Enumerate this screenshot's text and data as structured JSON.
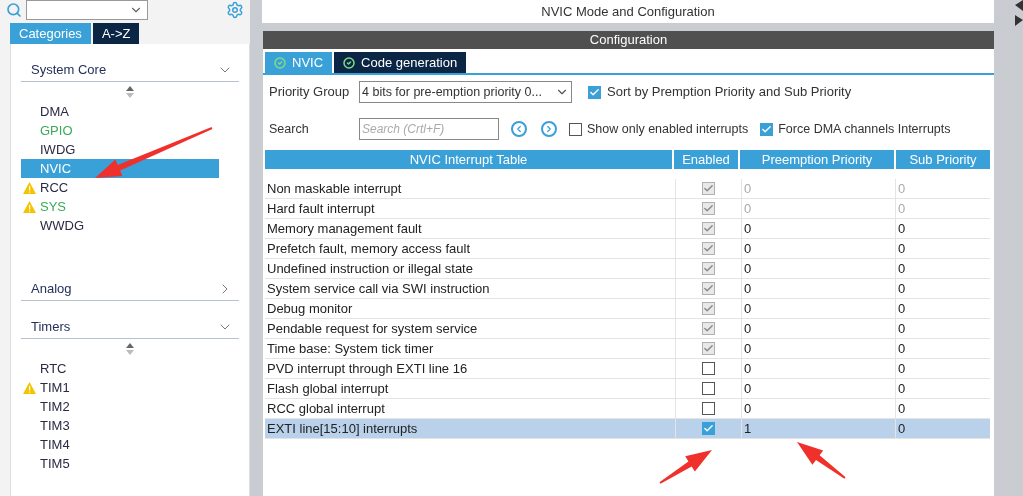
{
  "sidebar": {
    "tabs": [
      {
        "label": "Categories",
        "selected": true
      },
      {
        "label": "A->Z",
        "selected": false
      }
    ],
    "sections": [
      {
        "title": "System Core",
        "expanded": true,
        "items": [
          {
            "label": "DMA",
            "configured": false,
            "warning": false,
            "selected": false
          },
          {
            "label": "GPIO",
            "configured": true,
            "warning": false,
            "selected": false
          },
          {
            "label": "IWDG",
            "configured": false,
            "warning": false,
            "selected": false
          },
          {
            "label": "NVIC",
            "configured": false,
            "warning": false,
            "selected": true
          },
          {
            "label": "RCC",
            "configured": false,
            "warning": true,
            "selected": false
          },
          {
            "label": "SYS",
            "configured": true,
            "warning": true,
            "selected": false
          },
          {
            "label": "WWDG",
            "configured": false,
            "warning": false,
            "selected": false
          }
        ]
      },
      {
        "title": "Analog",
        "expanded": false
      },
      {
        "title": "Timers",
        "expanded": true,
        "items": [
          {
            "label": "RTC",
            "configured": false,
            "warning": false,
            "selected": false
          },
          {
            "label": "TIM1",
            "configured": false,
            "warning": true,
            "selected": false
          },
          {
            "label": "TIM2",
            "configured": false,
            "warning": false,
            "selected": false
          },
          {
            "label": "TIM3",
            "configured": false,
            "warning": false,
            "selected": false
          },
          {
            "label": "TIM4",
            "configured": false,
            "warning": false,
            "selected": false
          },
          {
            "label": "TIM5",
            "configured": false,
            "warning": false,
            "selected": false
          }
        ]
      }
    ]
  },
  "main": {
    "title": "NVIC Mode and Configuration",
    "config_header": "Configuration",
    "tabs": [
      {
        "label": "NVIC",
        "selected": true
      },
      {
        "label": "Code generation",
        "selected": false
      }
    ],
    "priority_group": {
      "label": "Priority Group",
      "value": "4 bits for pre-emption priority 0..."
    },
    "sort_option": {
      "label": "Sort by Premption Priority and Sub Priority",
      "checked": true
    },
    "search": {
      "label": "Search",
      "placeholder": "Search (Crtl+F)"
    },
    "show_only_enabled": {
      "label": "Show only enabled interrupts",
      "checked": false
    },
    "force_dma": {
      "label": "Force DMA channels Interrupts",
      "checked": true
    },
    "table": {
      "columns": [
        "NVIC Interrupt Table",
        "Enabled",
        "Preemption Priority",
        "Sub Priority"
      ],
      "rows": [
        {
          "name": "Non maskable interrupt",
          "enabled": true,
          "enable_locked": true,
          "preemption": "0",
          "sub": "0",
          "priority_locked": true,
          "selected": false
        },
        {
          "name": "Hard fault interrupt",
          "enabled": true,
          "enable_locked": true,
          "preemption": "0",
          "sub": "0",
          "priority_locked": true,
          "selected": false
        },
        {
          "name": "Memory management fault",
          "enabled": true,
          "enable_locked": true,
          "preemption": "0",
          "sub": "0",
          "priority_locked": false,
          "selected": false
        },
        {
          "name": "Prefetch fault, memory access fault",
          "enabled": true,
          "enable_locked": true,
          "preemption": "0",
          "sub": "0",
          "priority_locked": false,
          "selected": false
        },
        {
          "name": "Undefined instruction or illegal state",
          "enabled": true,
          "enable_locked": true,
          "preemption": "0",
          "sub": "0",
          "priority_locked": false,
          "selected": false
        },
        {
          "name": "System service call via SWI instruction",
          "enabled": true,
          "enable_locked": true,
          "preemption": "0",
          "sub": "0",
          "priority_locked": false,
          "selected": false
        },
        {
          "name": "Debug monitor",
          "enabled": true,
          "enable_locked": true,
          "preemption": "0",
          "sub": "0",
          "priority_locked": false,
          "selected": false
        },
        {
          "name": "Pendable request for system service",
          "enabled": true,
          "enable_locked": true,
          "preemption": "0",
          "sub": "0",
          "priority_locked": false,
          "selected": false
        },
        {
          "name": "Time base: System tick timer",
          "enabled": true,
          "enable_locked": true,
          "preemption": "0",
          "sub": "0",
          "priority_locked": false,
          "selected": false
        },
        {
          "name": "PVD interrupt through EXTI line 16",
          "enabled": false,
          "enable_locked": false,
          "preemption": "0",
          "sub": "0",
          "priority_locked": false,
          "selected": false
        },
        {
          "name": "Flash global interrupt",
          "enabled": false,
          "enable_locked": false,
          "preemption": "0",
          "sub": "0",
          "priority_locked": false,
          "selected": false
        },
        {
          "name": "RCC global interrupt",
          "enabled": false,
          "enable_locked": false,
          "preemption": "0",
          "sub": "0",
          "priority_locked": false,
          "selected": false
        },
        {
          "name": "EXTI line[15:10] interrupts",
          "enabled": true,
          "enable_locked": false,
          "preemption": "1",
          "sub": "0",
          "priority_locked": false,
          "selected": true
        }
      ]
    }
  }
}
